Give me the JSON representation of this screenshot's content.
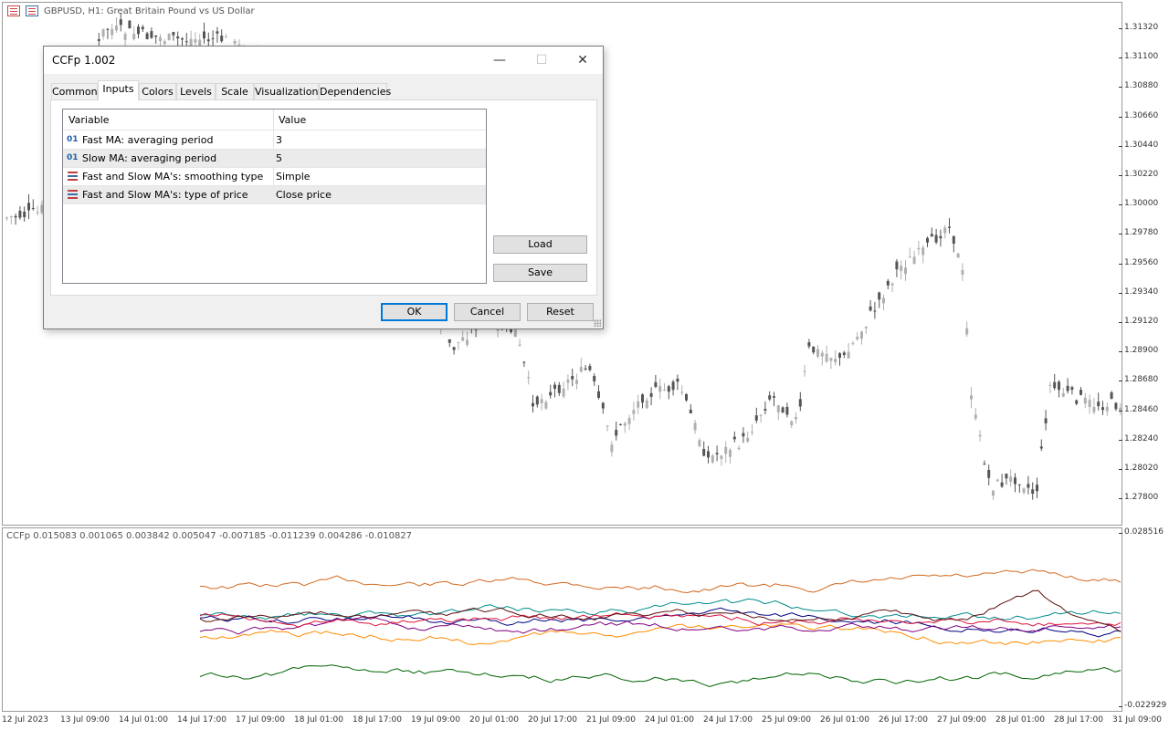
{
  "chart": {
    "title": "GBPUSD, H1:  Great Britain Pound vs US Dollar",
    "price_ticks": [
      "1.31320",
      "1.31100",
      "1.30880",
      "1.30660",
      "1.30440",
      "1.30220",
      "1.30000",
      "1.29780",
      "1.29560",
      "1.29340",
      "1.29120",
      "1.28900",
      "1.28680",
      "1.28460",
      "1.28240",
      "1.28020",
      "1.27800"
    ],
    "time_labels": [
      "12 Jul 2023",
      "13 Jul 09:00",
      "14 Jul 01:00",
      "14 Jul 17:00",
      "17 Jul 09:00",
      "18 Jul 01:00",
      "18 Jul 17:00",
      "19 Jul 09:00",
      "20 Jul 01:00",
      "20 Jul 17:00",
      "21 Jul 09:00",
      "24 Jul 01:00",
      "24 Jul 17:00",
      "25 Jul 09:00",
      "26 Jul 01:00",
      "26 Jul 17:00",
      "27 Jul 09:00",
      "28 Jul 01:00",
      "28 Jul 17:00",
      "31 Jul 09:00"
    ]
  },
  "indicator": {
    "title": "CCFp 0.015083 0.001065 0.003842 0.005047 -0.007185 -0.011239 0.004286 -0.010827",
    "scale_top": "0.028516",
    "scale_bottom": "-0.022929",
    "colors": [
      "#d2691e",
      "#008b8b",
      "#000080",
      "#ff8c00",
      "#800080",
      "#006400",
      "#dc143c",
      "#5c1010"
    ]
  },
  "dialog": {
    "title": "CCFp 1.002",
    "minimize": "—",
    "maximize": "☐",
    "close": "✕",
    "tabs": [
      "Common",
      "Inputs",
      "Colors",
      "Levels",
      "Scale",
      "Visualization",
      "Dependencies"
    ],
    "active_tab": "Inputs",
    "grid": {
      "headers": [
        "Variable",
        "Value"
      ],
      "rows": [
        {
          "type": "int",
          "icon": "01",
          "variable": "Fast MA: averaging period",
          "value": "3"
        },
        {
          "type": "int",
          "icon": "01",
          "variable": "Slow MA: averaging period",
          "value": "5"
        },
        {
          "type": "enum",
          "icon": "",
          "variable": "Fast and Slow MA's: smoothing type",
          "value": "Simple"
        },
        {
          "type": "enum",
          "icon": "",
          "variable": "Fast and Slow MA's: type of price",
          "value": "Close price"
        }
      ]
    },
    "buttons": {
      "load": "Load",
      "save": "Save",
      "ok": "OK",
      "cancel": "Cancel",
      "reset": "Reset"
    }
  }
}
